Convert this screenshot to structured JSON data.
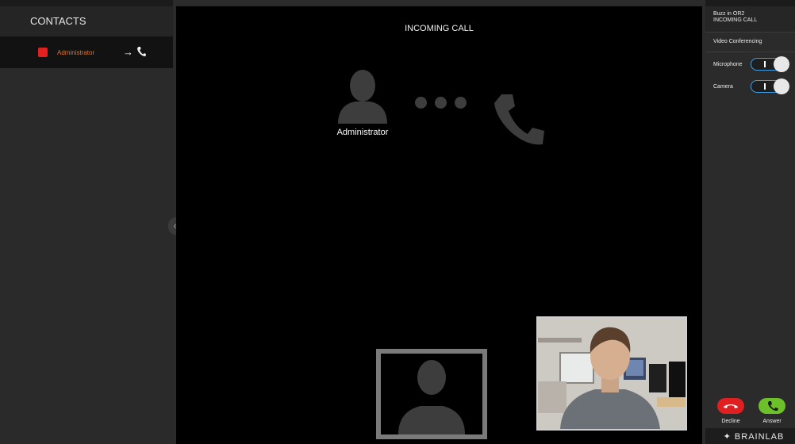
{
  "contacts": {
    "header": "CONTACTS",
    "items": [
      {
        "name": "Administrator",
        "status_color": "#e12020",
        "action_arrow": "→"
      }
    ]
  },
  "collapse_label": "«",
  "call": {
    "title": "INCOMING CALL",
    "caller_name": "Administrator"
  },
  "right_panel": {
    "status_line1": "Buzz in OR2",
    "status_line2": "INCOMING CALL",
    "section": "Video Conferencing",
    "microphone_label": "Microphone",
    "camera_label": "Camera",
    "decline_label": "Decline",
    "answer_label": "Answer"
  },
  "brand": "BRAINLAB",
  "colors": {
    "accent": "#3aa0e8",
    "decline": "#e02020",
    "answer": "#6cc02a",
    "contact_name": "#e0742b"
  }
}
